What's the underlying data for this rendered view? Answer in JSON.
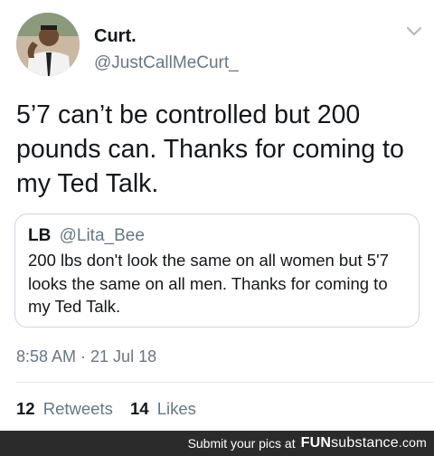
{
  "author": {
    "display_name": "Curt.",
    "handle": "@JustCallMeCurt_"
  },
  "tweet": {
    "text": "5’7 can’t be controlled but 200 pounds can. Thanks for coming to my Ted Talk."
  },
  "quoted_tweet": {
    "display_name": "LB",
    "handle": "@Lita_Bee",
    "text": "200 lbs don't look the same on all women but 5'7 looks the same on all men. Thanks for coming to my Ted Talk."
  },
  "timestamp": "8:58 AM · 21 Jul 18",
  "stats": {
    "retweets_count": "12",
    "retweets_label": "Retweets",
    "likes_count": "14",
    "likes_label": "Likes"
  },
  "footer": {
    "text": "Submit your pics at",
    "logo_part1": "FUN",
    "logo_part2": "substance",
    "logo_part3": ".com"
  },
  "colors": {
    "text_primary": "#14171a",
    "text_secondary": "#657786",
    "border": "#ccd6dd",
    "footer_bg": "#2b2b2b"
  },
  "icons": {
    "menu": "chevron-down-icon"
  }
}
